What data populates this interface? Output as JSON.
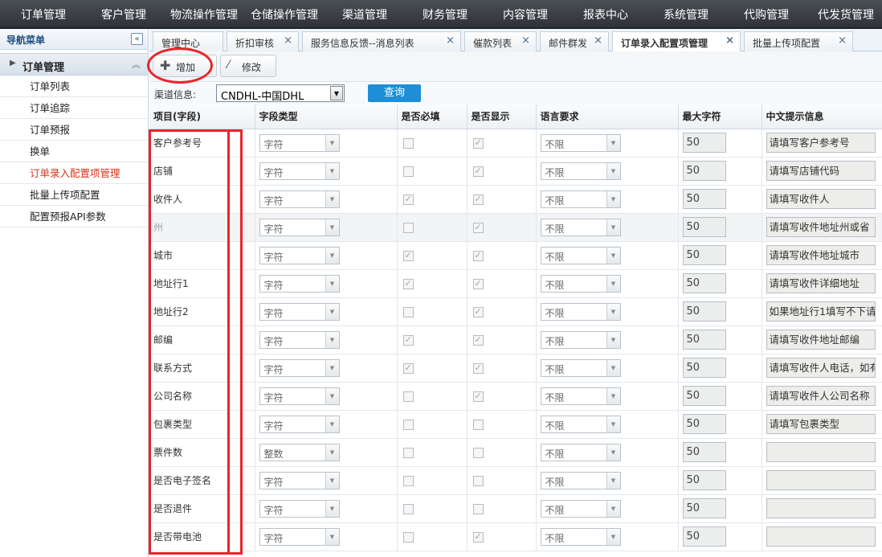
{
  "topnav": {
    "items": [
      "订单管理",
      "客户管理",
      "物流操作管理",
      "仓储操作管理",
      "渠道管理",
      "财务管理",
      "内容管理",
      "报表中心",
      "系统管理",
      "代购管理",
      "代发货管理"
    ]
  },
  "sidebar": {
    "title": "导航菜单",
    "collapse_glyph": "«",
    "group": {
      "label": "订单管理",
      "arrow": "▶",
      "chevron": "︽"
    },
    "items": [
      {
        "label": "订单列表"
      },
      {
        "label": "订单追踪"
      },
      {
        "label": "订单预报"
      },
      {
        "label": "换单"
      },
      {
        "label": "订单录入配置项管理",
        "active": true
      },
      {
        "label": "批量上传项配置"
      },
      {
        "label": "配置预报API参数"
      }
    ]
  },
  "tabs": [
    {
      "label": "管理中心",
      "closable": false
    },
    {
      "label": "折扣审核",
      "closable": true
    },
    {
      "label": "服务信息反馈--消息列表",
      "closable": true
    },
    {
      "label": "催款列表",
      "closable": true
    },
    {
      "label": "邮件群发",
      "closable": true
    },
    {
      "label": "订单录入配置项管理",
      "closable": true,
      "active": true
    },
    {
      "label": "批量上传项配置",
      "closable": true
    }
  ],
  "tab_close_glyph": "×",
  "toolbar": {
    "add_label": "增加",
    "add_icon": "plus-icon",
    "edit_label": "修改",
    "edit_icon": "magic-wand-icon"
  },
  "filter": {
    "channel_label": "渠道信息:",
    "channel_value": "CNDHL-中国DHL",
    "query_label": "查询"
  },
  "table": {
    "headers": [
      "项目(字段)",
      "字段类型",
      "是否必填",
      "是否显示",
      "语言要求",
      "最大字符",
      "中文提示信息"
    ],
    "rows": [
      {
        "name": "客户参考号",
        "type": "字符",
        "required": false,
        "shown": true,
        "lang": "不限",
        "max": "50",
        "hint": "请填写客户参考号"
      },
      {
        "name": "店铺",
        "type": "字符",
        "required": false,
        "shown": true,
        "lang": "不限",
        "max": "50",
        "hint": "请填写店铺代码"
      },
      {
        "name": "收件人",
        "type": "字符",
        "required": true,
        "shown": true,
        "lang": "不限",
        "max": "50",
        "hint": "请填写收件人"
      },
      {
        "name": "州",
        "type": "字符",
        "required": false,
        "shown": true,
        "lang": "不限",
        "max": "50",
        "hint": "请填写收件地址州或省",
        "dim": true
      },
      {
        "name": "城市",
        "type": "字符",
        "required": true,
        "shown": true,
        "lang": "不限",
        "max": "50",
        "hint": "请填写收件地址城市"
      },
      {
        "name": "地址行1",
        "type": "字符",
        "required": true,
        "shown": true,
        "lang": "不限",
        "max": "50",
        "hint": "请填写收件详细地址"
      },
      {
        "name": "地址行2",
        "type": "字符",
        "required": false,
        "shown": true,
        "lang": "不限",
        "max": "50",
        "hint": "如果地址行1填写不下请"
      },
      {
        "name": "邮编",
        "type": "字符",
        "required": true,
        "shown": true,
        "lang": "不限",
        "max": "50",
        "hint": "请填写收件地址邮编"
      },
      {
        "name": "联系方式",
        "type": "字符",
        "required": true,
        "shown": true,
        "lang": "不限",
        "max": "50",
        "hint": "请填写收件人电话，如有"
      },
      {
        "name": "公司名称",
        "type": "字符",
        "required": false,
        "shown": true,
        "lang": "不限",
        "max": "50",
        "hint": "请填写收件人公司名称"
      },
      {
        "name": "包裹类型",
        "type": "字符",
        "required": false,
        "shown": false,
        "lang": "不限",
        "max": "50",
        "hint": "请填写包裹类型"
      },
      {
        "name": "票件数",
        "type": "整数",
        "required": false,
        "shown": false,
        "lang": "不限",
        "max": "50",
        "hint": ""
      },
      {
        "name": "是否电子签名",
        "type": "字符",
        "required": false,
        "shown": false,
        "lang": "不限",
        "max": "50",
        "hint": ""
      },
      {
        "name": "是否退件",
        "type": "字符",
        "required": false,
        "shown": false,
        "lang": "不限",
        "max": "50",
        "hint": ""
      },
      {
        "name": "是否带电池",
        "type": "字符",
        "required": false,
        "shown": true,
        "lang": "不限",
        "max": "50",
        "hint": ""
      }
    ]
  },
  "colors": {
    "annotation_red": "#e8242b",
    "query_blue": "#1e8ed6",
    "active_sidebar": "#d4351c"
  }
}
